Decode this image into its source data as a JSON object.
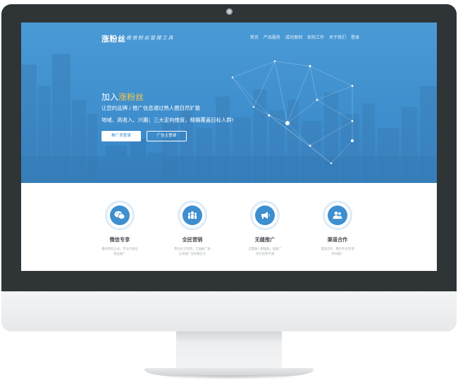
{
  "site": {
    "logo": "涨粉丝",
    "slogan": "微信粉丝管理工具"
  },
  "nav": {
    "items": [
      "首页",
      "产品服务",
      "成功案例",
      "如何工作",
      "关于我们",
      "登录"
    ]
  },
  "hero": {
    "title_prefix": "加入",
    "title_accent": "涨粉丝",
    "line1": "让您的品牌 / 推广信息通过熟人圈自然扩散",
    "line2": "地域、高收入、兴趣；三大定向维度，精确覆盖目标人群!",
    "primary_button": "推广员登录",
    "secondary_button": "广告主登录"
  },
  "features": [
    {
      "icon": "wechat-icon",
      "title": "微信专享",
      "desc_1": "最好用的方式，专注于微信",
      "desc_2": "粉丝推广"
    },
    {
      "icon": "people-icon",
      "title": "全民营销",
      "desc_1": "我为社交营销，全面推广粉",
      "desc_2": "方式推广您的微信号"
    },
    {
      "icon": "megaphone-icon",
      "title": "无缝推广",
      "desc_1": "无需融入圈操群，就推广",
      "desc_2": "来无往而不通"
    },
    {
      "icon": "partner-icon",
      "title": "渠道合作",
      "desc_1": "渠道合作，整合平台资源",
      "desc_2": "共同推广"
    }
  ],
  "colors": {
    "hero_blue": "#4a9ad6",
    "accent_yellow": "#f6c849",
    "icon_blue": "#3d8fd0",
    "bezel": "#2f3437"
  }
}
